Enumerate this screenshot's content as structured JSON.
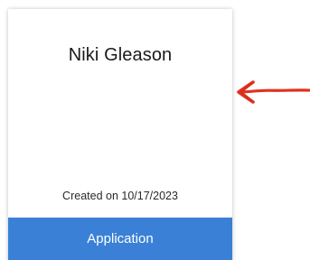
{
  "card": {
    "name": "Niki Gleason",
    "created": "Created on 10/17/2023",
    "button_label": "Application"
  },
  "colors": {
    "button_background": "#3a80d6",
    "button_text": "#ffffff",
    "annotation_arrow": "#e0321e"
  },
  "annotation": {
    "icon": "red-hand-drawn-arrow-icon"
  }
}
